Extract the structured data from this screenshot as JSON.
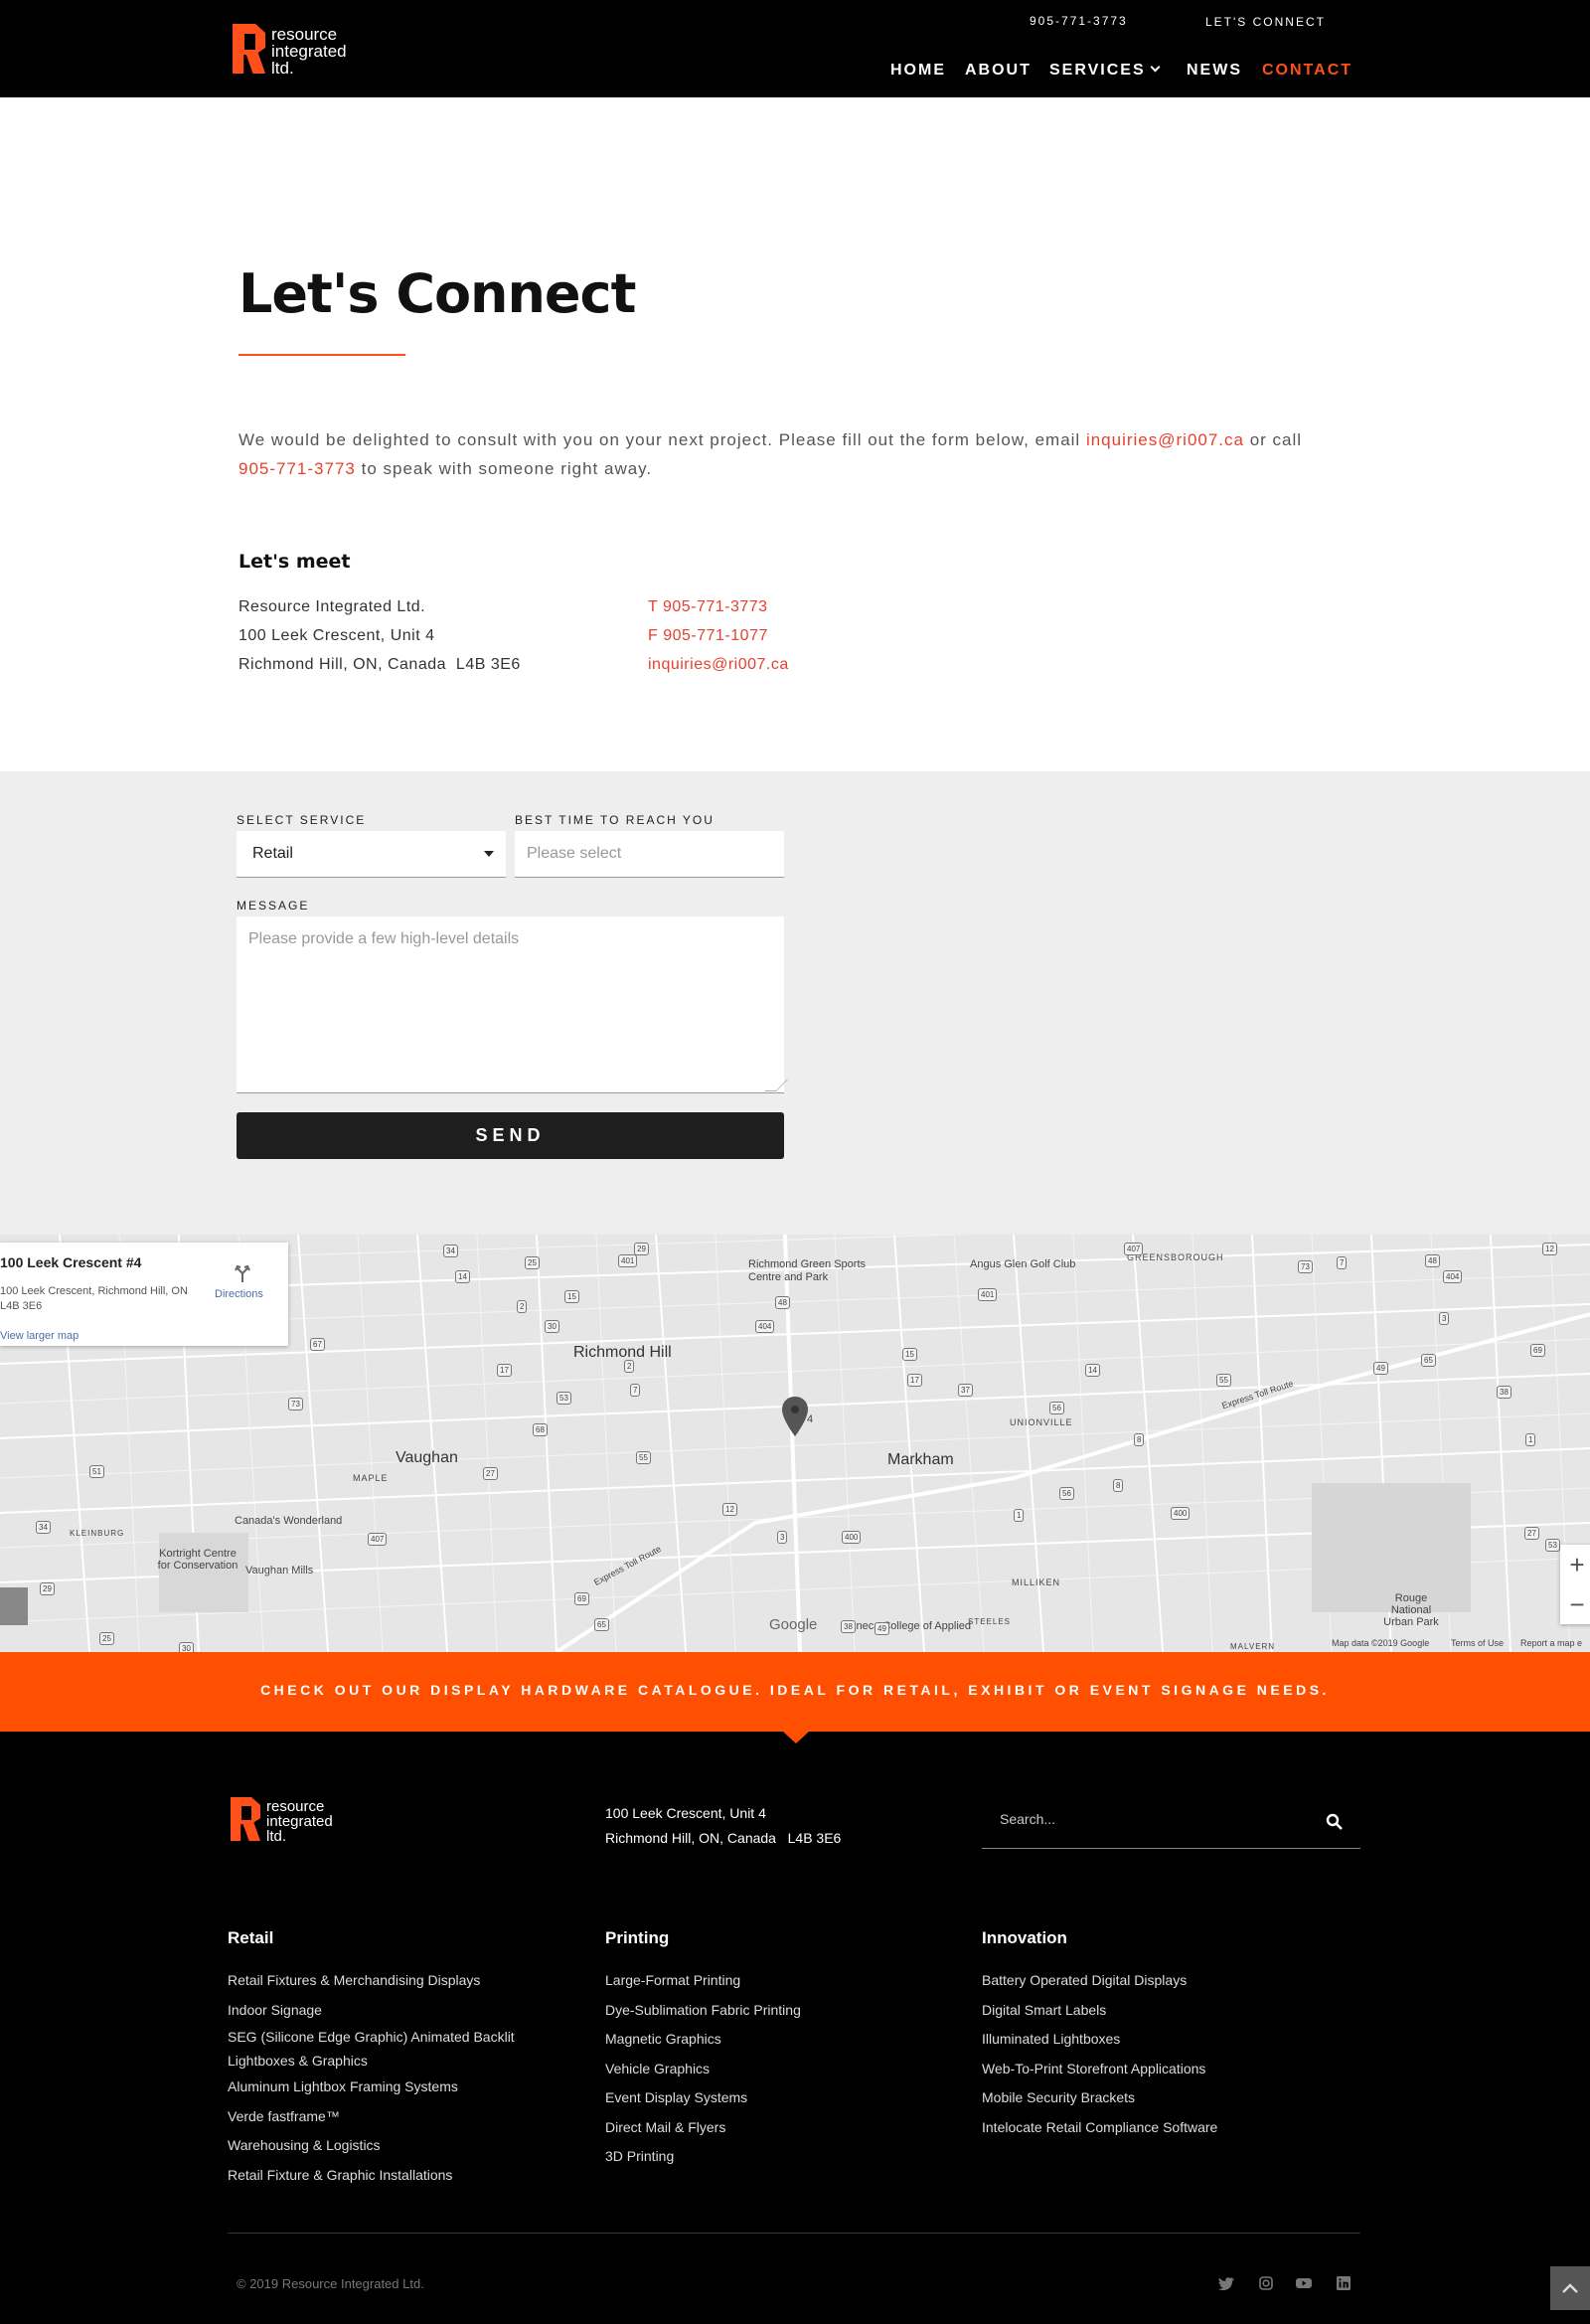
{
  "brand": {
    "logo_lines": [
      "resource",
      "integrated",
      "ltd."
    ],
    "accent": "#ff4f1a"
  },
  "topbar": {
    "phone": "905-771-3773",
    "connect": "LET'S CONNECT"
  },
  "nav": {
    "items": [
      {
        "label": "HOME"
      },
      {
        "label": "ABOUT"
      },
      {
        "label": "SERVICES"
      },
      {
        "label": "NEWS"
      },
      {
        "label": "CONTACT"
      }
    ],
    "active": "CONTACT"
  },
  "intro": {
    "title": "Let's Connect",
    "text_1": "We would be delighted to consult with you on your next project. Please fill out the form below, email ",
    "email": "inquiries@ri007.ca",
    "text_2": " or call ",
    "phone": "905-771-3773",
    "text_3": " to speak with someone right away."
  },
  "meet": {
    "title": "Let's meet",
    "address": [
      "Resource Integrated Ltd.",
      "100 Leek Crescent, Unit 4",
      "Richmond Hill, ON, Canada  L4B 3E6"
    ],
    "tel_prefix": "T",
    "tel": "905-771-3773",
    "fax_prefix": "F",
    "fax": "905-771-1077",
    "email": "inquiries@ri007.ca"
  },
  "form": {
    "service_label": "SELECT SERVICE",
    "service_value": "Retail",
    "time_label": "BEST TIME TO REACH YOU",
    "time_placeholder": "Please select",
    "message_label": "MESSAGE",
    "message_placeholder": "Please provide a few high-level details",
    "send_label": "SEND"
  },
  "map": {
    "card_title": "100 Leek Crescent #4",
    "card_address": "100 Leek Crescent, Richmond Hill, ON L4B 3E6",
    "card_link": "View larger map",
    "directions": "Directions",
    "cities": [
      "Richmond Hill",
      "Vaughan",
      "Markham"
    ],
    "places": [
      "Richmond Green Sports Centre and Park",
      "Angus Glen Golf Club",
      "Canada's Wonderland",
      "Vaughan Mills",
      "Kortright Centre for Conservation",
      "Seneca College of Applied",
      "Rouge National Urban Park"
    ],
    "area_labels": [
      "GREENSBOROUGH",
      "UNIONVILLE",
      "MAPLE",
      "KLEINBURG",
      "MILLIKEN",
      "STEELES",
      "MALVERN"
    ],
    "road_labels": [
      "Express Toll Route",
      "Express Toll Route"
    ],
    "route_numbers": [
      "34",
      "29",
      "25",
      "30",
      "407",
      "73",
      "7",
      "48",
      "404",
      "12",
      "3",
      "65",
      "69",
      "49",
      "38",
      "1",
      "8",
      "400",
      "55",
      "53",
      "27",
      "2",
      "14",
      "15",
      "401",
      "17",
      "56",
      "37",
      "68",
      "67",
      "51"
    ],
    "pin_label": "4",
    "google": "Google",
    "attribution": [
      "Map data ©2019 Google",
      "Terms of Use",
      "Report a map e"
    ],
    "zoom_in": "+",
    "zoom_out": "−"
  },
  "banner": {
    "text": "CHECK OUT OUR DISPLAY HARDWARE CATALOGUE. IDEAL FOR RETAIL, EXHIBIT OR EVENT SIGNAGE NEEDS."
  },
  "footer": {
    "address": [
      "100 Leek Crescent, Unit 4",
      "Richmond Hill, ON, Canada   L4B 3E6"
    ],
    "search_placeholder": "Search...",
    "columns": [
      {
        "title": "Retail",
        "items": [
          "Retail Fixtures & Merchandising Displays",
          "Indoor Signage",
          "SEG (Silicone Edge Graphic) Animated Backlit",
          "Lightboxes & Graphics",
          "Aluminum Lightbox Framing Systems",
          "Verde fastframe™",
          "Warehousing & Logistics",
          "Retail Fixture & Graphic Installations"
        ]
      },
      {
        "title": "Printing",
        "items": [
          "Large-Format Printing",
          "Dye-Sublimation Fabric Printing",
          "Magnetic Graphics",
          "Vehicle Graphics",
          "Event Display Systems",
          "Direct Mail & Flyers",
          "3D Printing"
        ]
      },
      {
        "title": "Innovation",
        "items": [
          "Battery Operated Digital Displays",
          "Digital Smart Labels",
          "Illuminated Lightboxes",
          "Web-To-Print Storefront Applications",
          "Mobile Security Brackets",
          "Intelocate Retail Compliance Software"
        ]
      }
    ],
    "copyright": "© 2019 Resource Integrated Ltd.",
    "social": [
      "twitter-icon",
      "instagram-icon",
      "youtube-icon",
      "linkedin-icon"
    ]
  }
}
